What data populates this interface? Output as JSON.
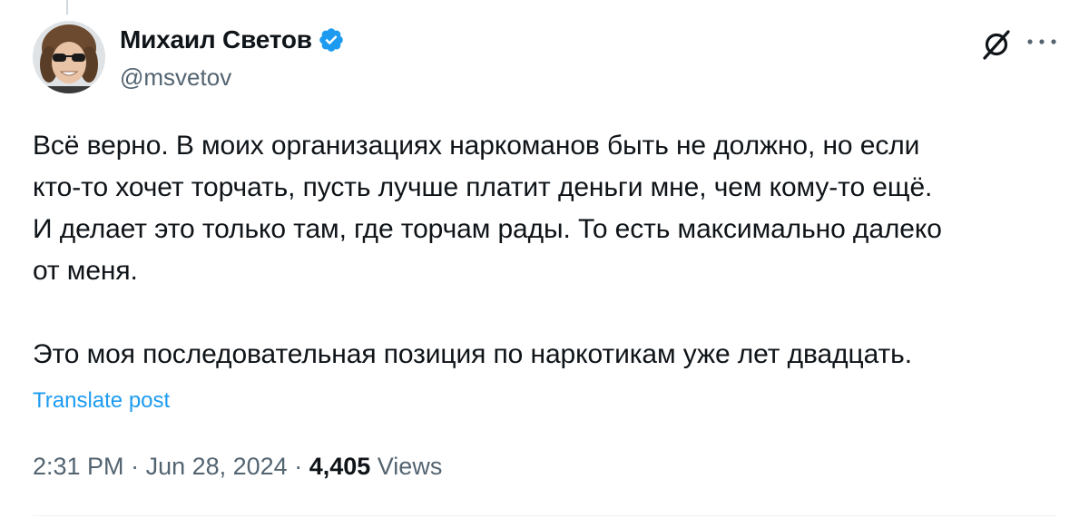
{
  "tweet": {
    "author": {
      "display_name": "Михаил Светов",
      "handle": "@msvetov",
      "verified": true
    },
    "text": "Всё верно. В моих организациях наркоманов быть не должно, но если\nкто-то хочет торчать, пусть лучше платит деньги мне, чем кому-то ещё.\nИ делает это только там, где торчам рады. То есть максимально далеко\nот меня.\n\nЭто моя последовательная позиция по наркотикам уже лет двадцать.",
    "translate_label": "Translate post",
    "time": "2:31 PM",
    "date": "Jun 28, 2024",
    "separator": " · ",
    "views_count": "4,405",
    "views_label": " Views"
  },
  "icons": {
    "verified": "verified-badge-icon",
    "grok": "grok-icon",
    "more": "more-options-icon",
    "avatar": "avatar-photo"
  },
  "colors": {
    "verified_blue": "#1d9bf0",
    "link_blue": "#1d9bf0",
    "secondary_text": "#536471",
    "primary_text": "#0f1419"
  }
}
